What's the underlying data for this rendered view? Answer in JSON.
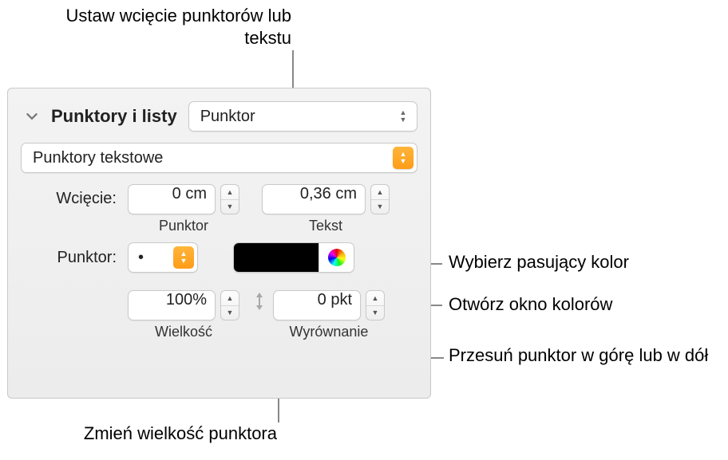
{
  "callouts": {
    "top": "Ustaw wcięcie punktorów lub tekstu",
    "color_match": "Wybierz pasujący kolor",
    "color_window": "Otwórz okno kolorów",
    "move_bullet": "Przesuń punktor w górę lub w dół",
    "size_change": "Zmień wielkość punktora"
  },
  "panel": {
    "section_title": "Punktory i listy",
    "style_select": "Punktor",
    "type_select": "Punktory tekstowe",
    "indent_label": "Wcięcie:",
    "indent_bullet_value": "0 cm",
    "indent_bullet_sub": "Punktor",
    "indent_text_value": "0,36 cm",
    "indent_text_sub": "Tekst",
    "bullet_label": "Punktor:",
    "bullet_char": "•",
    "size_value": "100%",
    "size_sub": "Wielkość",
    "align_value": "0 pkt",
    "align_sub": "Wyrównanie",
    "swatch_color": "#000000"
  }
}
